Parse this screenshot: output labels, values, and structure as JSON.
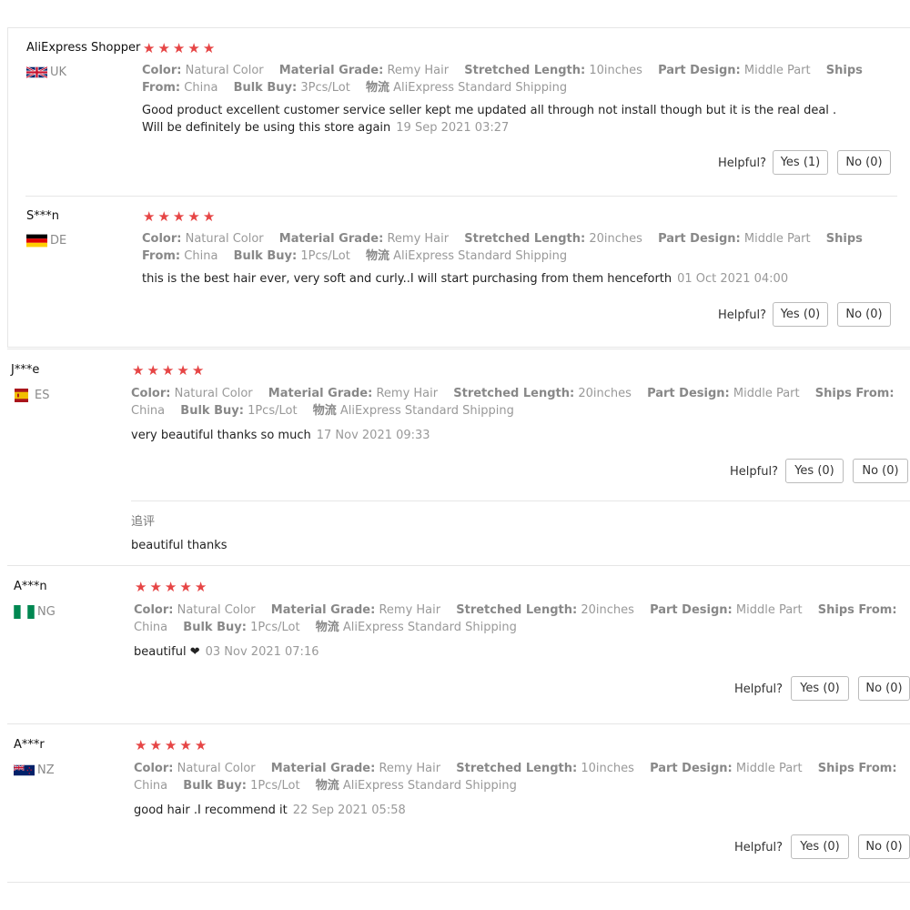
{
  "labels": {
    "color": "Color:",
    "material_grade": "Material Grade:",
    "stretched_length": "Stretched Length:",
    "part_design": "Part Design:",
    "ships_from": "Ships From:",
    "bulk_buy": "Bulk Buy:",
    "logistics": "物流",
    "helpful": "Helpful?"
  },
  "reviews": [
    {
      "user": "AliExpress Shopper",
      "country": "UK",
      "rating": 5,
      "color": "Natural Color",
      "material_grade": "Remy Hair",
      "stretched_length": "10inches",
      "part_design": "Middle Part",
      "ships_from": "China",
      "bulk_buy": "3Pcs/Lot",
      "shipping": "AliExpress Standard Shipping",
      "text_line1": "Good product excellent customer service seller kept me updated all through not install though but it is the real deal .",
      "text_line2": "Will be definitely be using this store again",
      "date": "19 Sep 2021 03:27",
      "yes": "Yes (1)",
      "no": "No (0)"
    },
    {
      "user": "S***n",
      "country": "DE",
      "rating": 5,
      "color": "Natural Color",
      "material_grade": "Remy Hair",
      "stretched_length": "20inches",
      "part_design": "Middle Part",
      "ships_from": "China",
      "bulk_buy": "1Pcs/Lot",
      "shipping": "AliExpress Standard Shipping",
      "text": "this is the best hair ever, very soft and curly..I will start purchasing from them henceforth",
      "date": "01 Oct 2021 04:00",
      "yes": "Yes (0)",
      "no": "No (0)"
    },
    {
      "user": "J***e",
      "country": "ES",
      "rating": 5,
      "color": "Natural Color",
      "material_grade": "Remy Hair",
      "stretched_length": "20inches",
      "part_design": "Middle Part",
      "ships_from": "China",
      "bulk_buy": "1Pcs/Lot",
      "shipping": "AliExpress Standard Shipping",
      "text": "very beautiful thanks so much",
      "date": "17 Nov 2021 09:33",
      "yes": "Yes (0)",
      "no": "No (0)",
      "followup_label": "追评",
      "followup_text": "beautiful thanks"
    },
    {
      "user": "A***n",
      "country": "NG",
      "rating": 5,
      "color": "Natural Color",
      "material_grade": "Remy Hair",
      "stretched_length": "20inches",
      "part_design": "Middle Part",
      "ships_from": "China",
      "bulk_buy": "1Pcs/Lot",
      "shipping": "AliExpress Standard Shipping",
      "text": "beautiful ❤",
      "date": "03 Nov 2021 07:16",
      "yes": "Yes (0)",
      "no": "No (0)"
    },
    {
      "user": "A***r",
      "country": "NZ",
      "rating": 5,
      "color": "Natural Color",
      "material_grade": "Remy Hair",
      "stretched_length": "10inches",
      "part_design": "Middle Part",
      "ships_from": "China",
      "bulk_buy": "1Pcs/Lot",
      "shipping": "AliExpress Standard Shipping",
      "text": "good hair .I recommend it",
      "date": "22 Sep 2021 05:58",
      "yes": "Yes (0)",
      "no": "No (0)"
    }
  ],
  "colors": {
    "star": "#e64545",
    "divider": "#e6e6e6"
  }
}
